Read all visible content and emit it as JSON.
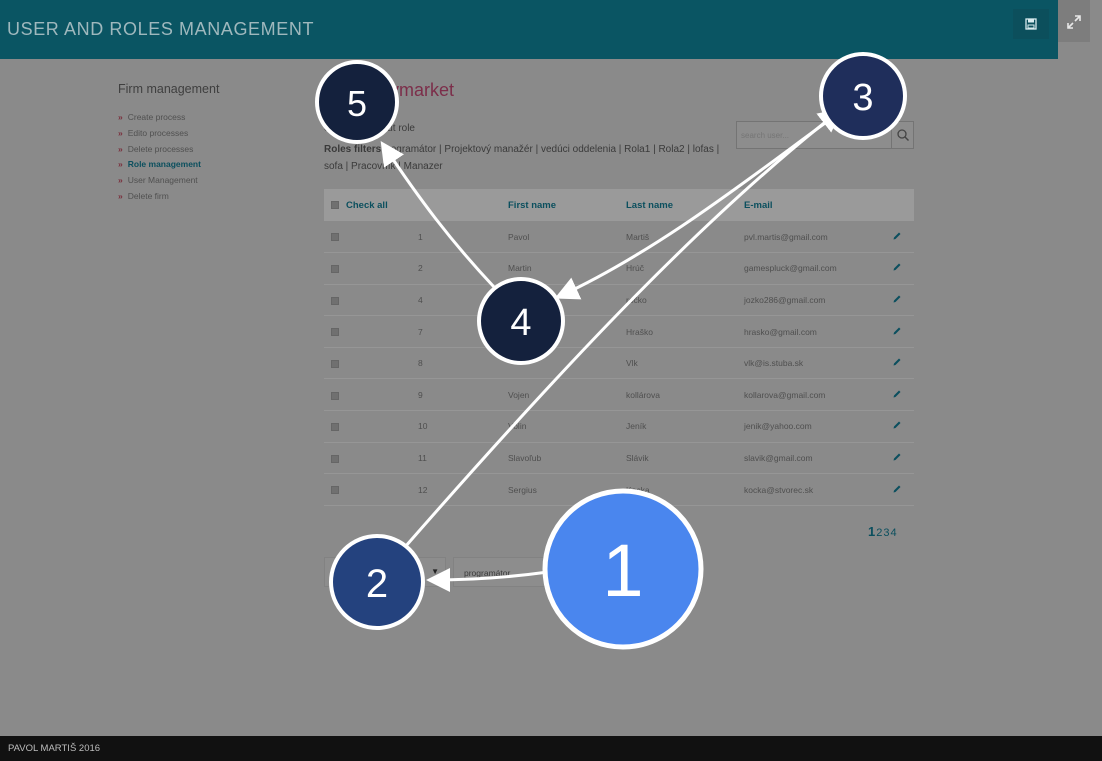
{
  "header": {
    "title": "USER AND ROLES MANAGEMENT",
    "save_icon": "save-icon",
    "expand_icon": "expand-icon"
  },
  "sidebar": {
    "title": "Firm management",
    "items": [
      {
        "label": "Create process"
      },
      {
        "label": "Edito processes"
      },
      {
        "label": "Delete processes"
      },
      {
        "label": "Role management",
        "active": true
      },
      {
        "label": "User Management"
      },
      {
        "label": "Delete firm"
      }
    ]
  },
  "main": {
    "title_visible": "ymarket",
    "filter_prefix": "e:",
    "filter_all": "All",
    "filter_without": "Whithout role",
    "roles_label": "Roles filters:",
    "roles_text1": "rogramátor | Projektový manažér | vedúci oddelenia | Rola1 | Rola2 | lofas |",
    "roles_text2": "sofa | Pracovník | Manazer",
    "search_placeholder": "search user..."
  },
  "table": {
    "check_all": "Check all",
    "headers": {
      "first": "First name",
      "last": "Last name",
      "email": "E-mail"
    },
    "rows": [
      {
        "id": "1",
        "first": "Pavol",
        "last": "Martiš",
        "email": "pvl.martis@gmail.com"
      },
      {
        "id": "2",
        "first": "Martin",
        "last": "Hrúč",
        "email": "gamespluck@gmail.com"
      },
      {
        "id": "4",
        "first": "",
        "last": "ročko",
        "email": "jozko286@gmail.com"
      },
      {
        "id": "7",
        "first": "",
        "last": "Hraško",
        "email": "hrasko@gmail.com"
      },
      {
        "id": "8",
        "first": "",
        "last": "Vlk",
        "email": "vlk@is.stuba.sk"
      },
      {
        "id": "9",
        "first": "Vojen",
        "last": "kollárova",
        "email": "kollarova@gmail.com"
      },
      {
        "id": "10",
        "first": "Volin",
        "last": "Jeník",
        "email": "jenik@yahoo.com"
      },
      {
        "id": "11",
        "first": "Slavoľub",
        "last": "Slávik",
        "email": "slavik@gmail.com"
      },
      {
        "id": "12",
        "first": "Sergius",
        "last": "Kocka",
        "email": "kocka@stvorec.sk"
      }
    ]
  },
  "pagination": {
    "pages": [
      "1",
      "2",
      "3",
      "4"
    ],
    "current": "1"
  },
  "actions": {
    "select_arrow": "▼",
    "role_select_value": "programátor",
    "role_select_arrow": "▼"
  },
  "footer": {
    "text": "PAVOL MARTIŠ 2016"
  },
  "annotations": {
    "badges": [
      {
        "label": "1",
        "color": "#4a86ee"
      },
      {
        "label": "2",
        "color": "#24427e"
      },
      {
        "label": "3",
        "color": "#1f2e5b"
      },
      {
        "label": "4",
        "color": "#14213d"
      },
      {
        "label": "5",
        "color": "#14213d"
      }
    ]
  }
}
